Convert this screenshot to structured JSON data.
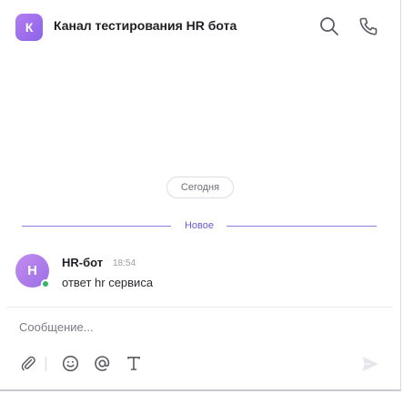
{
  "header": {
    "channel_initial": "К",
    "title": "Канал тестирования HR бота",
    "search_icon": "search-icon",
    "call_icon": "phone-icon"
  },
  "feed": {
    "date_label": "Сегодня",
    "new_divider_label": "Новое"
  },
  "message": {
    "avatar_initial": "Н",
    "author": "HR-бот",
    "time": "18:54",
    "text": "ответ hr сервиса",
    "presence": "online"
  },
  "composer": {
    "placeholder": "Сообщение...",
    "tools": [
      "paperclip-icon",
      "emoji-icon",
      "mention-icon",
      "text-format-icon"
    ],
    "send_icon": "send-icon"
  },
  "colors": {
    "accent": "#8a63e8",
    "divider": "#8e7be0",
    "online": "#2fb76a"
  }
}
